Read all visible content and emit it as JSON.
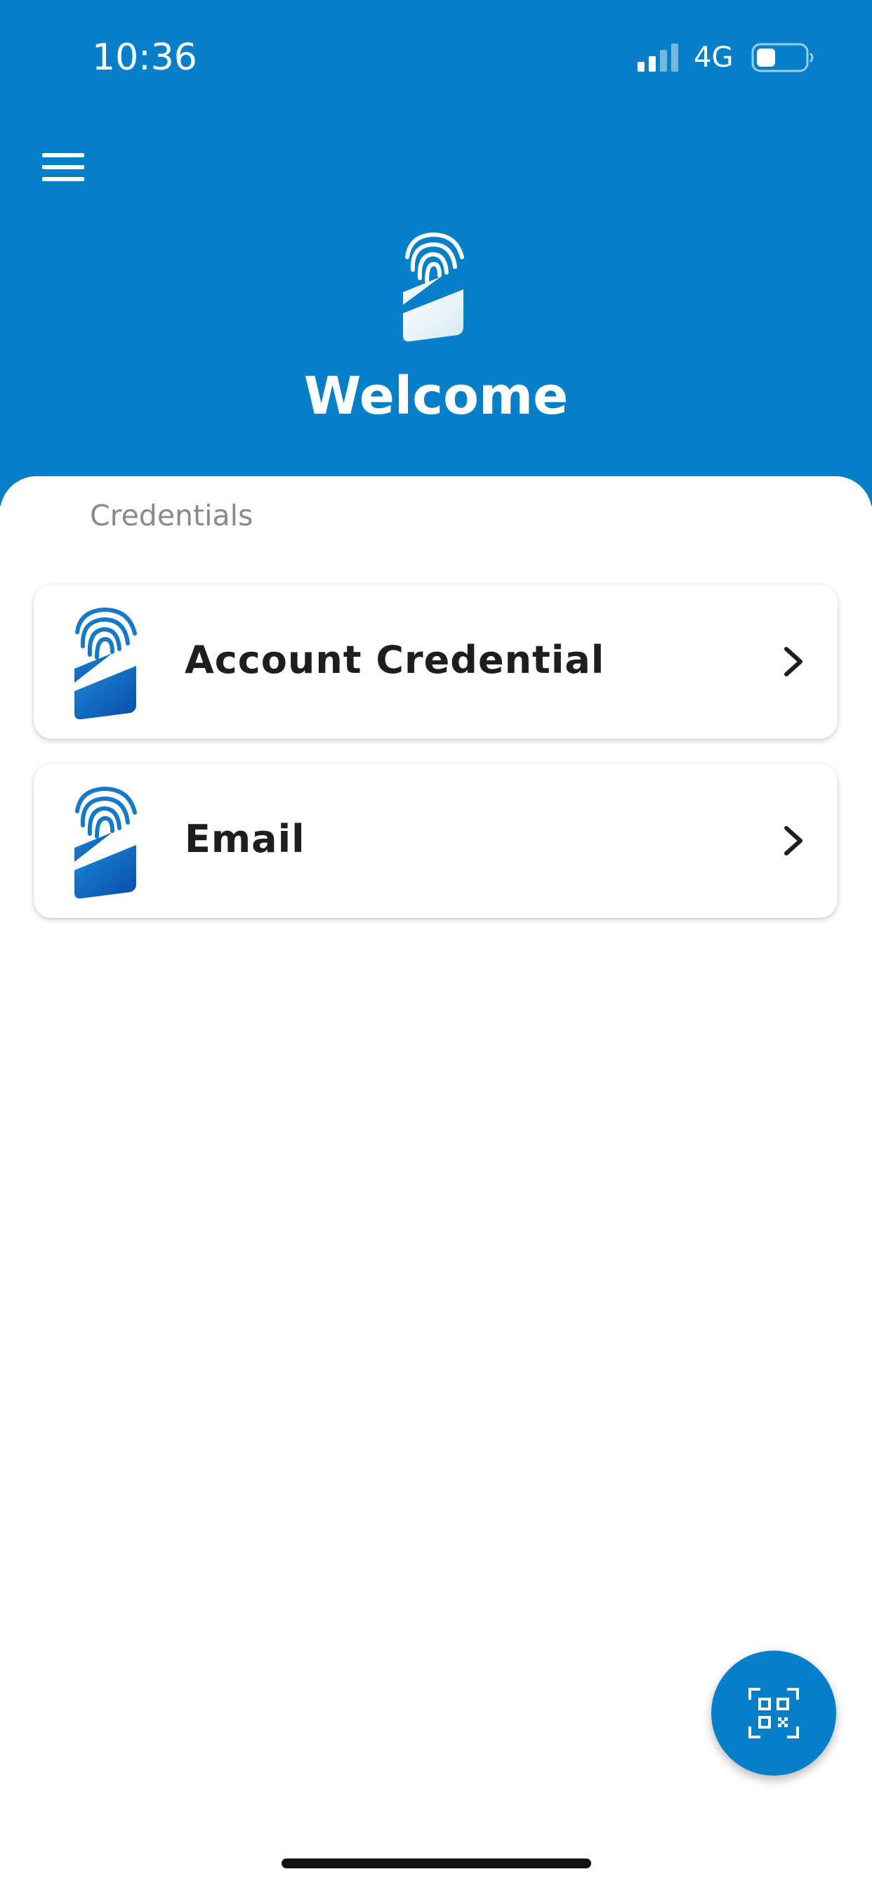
{
  "status_bar": {
    "time": "10:36",
    "network": "4G",
    "signal_icon": "cellular-signal-icon",
    "battery_icon": "battery-low-icon"
  },
  "header": {
    "menu_icon": "hamburger-menu-icon",
    "logo_icon": "fingerprint-id-card-logo-icon",
    "title": "Welcome"
  },
  "credentials": {
    "section_label": "Credentials",
    "items": [
      {
        "title": "Account Credential",
        "icon": "fingerprint-credential-icon",
        "chevron": "chevron-right-icon"
      },
      {
        "title": "Email",
        "icon": "fingerprint-credential-icon",
        "chevron": "chevron-right-icon"
      }
    ]
  },
  "fab": {
    "icon": "qr-code-scan-icon"
  },
  "colors": {
    "brand_blue": "#0580C8",
    "title_text": "#1E1E1E",
    "label_grey": "#8A8A8A",
    "background": "#FFFFFF"
  }
}
